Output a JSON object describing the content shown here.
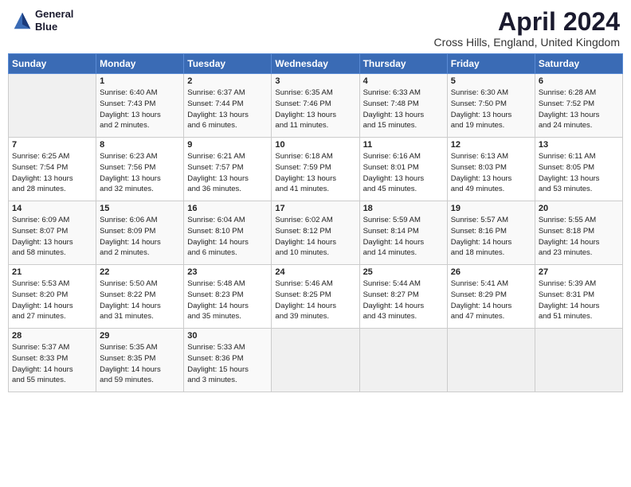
{
  "logo": {
    "line1": "General",
    "line2": "Blue"
  },
  "title": "April 2024",
  "location": "Cross Hills, England, United Kingdom",
  "days_header": [
    "Sunday",
    "Monday",
    "Tuesday",
    "Wednesday",
    "Thursday",
    "Friday",
    "Saturday"
  ],
  "weeks": [
    [
      {
        "day": "",
        "info": ""
      },
      {
        "day": "1",
        "info": "Sunrise: 6:40 AM\nSunset: 7:43 PM\nDaylight: 13 hours\nand 2 minutes."
      },
      {
        "day": "2",
        "info": "Sunrise: 6:37 AM\nSunset: 7:44 PM\nDaylight: 13 hours\nand 6 minutes."
      },
      {
        "day": "3",
        "info": "Sunrise: 6:35 AM\nSunset: 7:46 PM\nDaylight: 13 hours\nand 11 minutes."
      },
      {
        "day": "4",
        "info": "Sunrise: 6:33 AM\nSunset: 7:48 PM\nDaylight: 13 hours\nand 15 minutes."
      },
      {
        "day": "5",
        "info": "Sunrise: 6:30 AM\nSunset: 7:50 PM\nDaylight: 13 hours\nand 19 minutes."
      },
      {
        "day": "6",
        "info": "Sunrise: 6:28 AM\nSunset: 7:52 PM\nDaylight: 13 hours\nand 24 minutes."
      }
    ],
    [
      {
        "day": "7",
        "info": "Sunrise: 6:25 AM\nSunset: 7:54 PM\nDaylight: 13 hours\nand 28 minutes."
      },
      {
        "day": "8",
        "info": "Sunrise: 6:23 AM\nSunset: 7:56 PM\nDaylight: 13 hours\nand 32 minutes."
      },
      {
        "day": "9",
        "info": "Sunrise: 6:21 AM\nSunset: 7:57 PM\nDaylight: 13 hours\nand 36 minutes."
      },
      {
        "day": "10",
        "info": "Sunrise: 6:18 AM\nSunset: 7:59 PM\nDaylight: 13 hours\nand 41 minutes."
      },
      {
        "day": "11",
        "info": "Sunrise: 6:16 AM\nSunset: 8:01 PM\nDaylight: 13 hours\nand 45 minutes."
      },
      {
        "day": "12",
        "info": "Sunrise: 6:13 AM\nSunset: 8:03 PM\nDaylight: 13 hours\nand 49 minutes."
      },
      {
        "day": "13",
        "info": "Sunrise: 6:11 AM\nSunset: 8:05 PM\nDaylight: 13 hours\nand 53 minutes."
      }
    ],
    [
      {
        "day": "14",
        "info": "Sunrise: 6:09 AM\nSunset: 8:07 PM\nDaylight: 13 hours\nand 58 minutes."
      },
      {
        "day": "15",
        "info": "Sunrise: 6:06 AM\nSunset: 8:09 PM\nDaylight: 14 hours\nand 2 minutes."
      },
      {
        "day": "16",
        "info": "Sunrise: 6:04 AM\nSunset: 8:10 PM\nDaylight: 14 hours\nand 6 minutes."
      },
      {
        "day": "17",
        "info": "Sunrise: 6:02 AM\nSunset: 8:12 PM\nDaylight: 14 hours\nand 10 minutes."
      },
      {
        "day": "18",
        "info": "Sunrise: 5:59 AM\nSunset: 8:14 PM\nDaylight: 14 hours\nand 14 minutes."
      },
      {
        "day": "19",
        "info": "Sunrise: 5:57 AM\nSunset: 8:16 PM\nDaylight: 14 hours\nand 18 minutes."
      },
      {
        "day": "20",
        "info": "Sunrise: 5:55 AM\nSunset: 8:18 PM\nDaylight: 14 hours\nand 23 minutes."
      }
    ],
    [
      {
        "day": "21",
        "info": "Sunrise: 5:53 AM\nSunset: 8:20 PM\nDaylight: 14 hours\nand 27 minutes."
      },
      {
        "day": "22",
        "info": "Sunrise: 5:50 AM\nSunset: 8:22 PM\nDaylight: 14 hours\nand 31 minutes."
      },
      {
        "day": "23",
        "info": "Sunrise: 5:48 AM\nSunset: 8:23 PM\nDaylight: 14 hours\nand 35 minutes."
      },
      {
        "day": "24",
        "info": "Sunrise: 5:46 AM\nSunset: 8:25 PM\nDaylight: 14 hours\nand 39 minutes."
      },
      {
        "day": "25",
        "info": "Sunrise: 5:44 AM\nSunset: 8:27 PM\nDaylight: 14 hours\nand 43 minutes."
      },
      {
        "day": "26",
        "info": "Sunrise: 5:41 AM\nSunset: 8:29 PM\nDaylight: 14 hours\nand 47 minutes."
      },
      {
        "day": "27",
        "info": "Sunrise: 5:39 AM\nSunset: 8:31 PM\nDaylight: 14 hours\nand 51 minutes."
      }
    ],
    [
      {
        "day": "28",
        "info": "Sunrise: 5:37 AM\nSunset: 8:33 PM\nDaylight: 14 hours\nand 55 minutes."
      },
      {
        "day": "29",
        "info": "Sunrise: 5:35 AM\nSunset: 8:35 PM\nDaylight: 14 hours\nand 59 minutes."
      },
      {
        "day": "30",
        "info": "Sunrise: 5:33 AM\nSunset: 8:36 PM\nDaylight: 15 hours\nand 3 minutes."
      },
      {
        "day": "",
        "info": ""
      },
      {
        "day": "",
        "info": ""
      },
      {
        "day": "",
        "info": ""
      },
      {
        "day": "",
        "info": ""
      }
    ]
  ]
}
